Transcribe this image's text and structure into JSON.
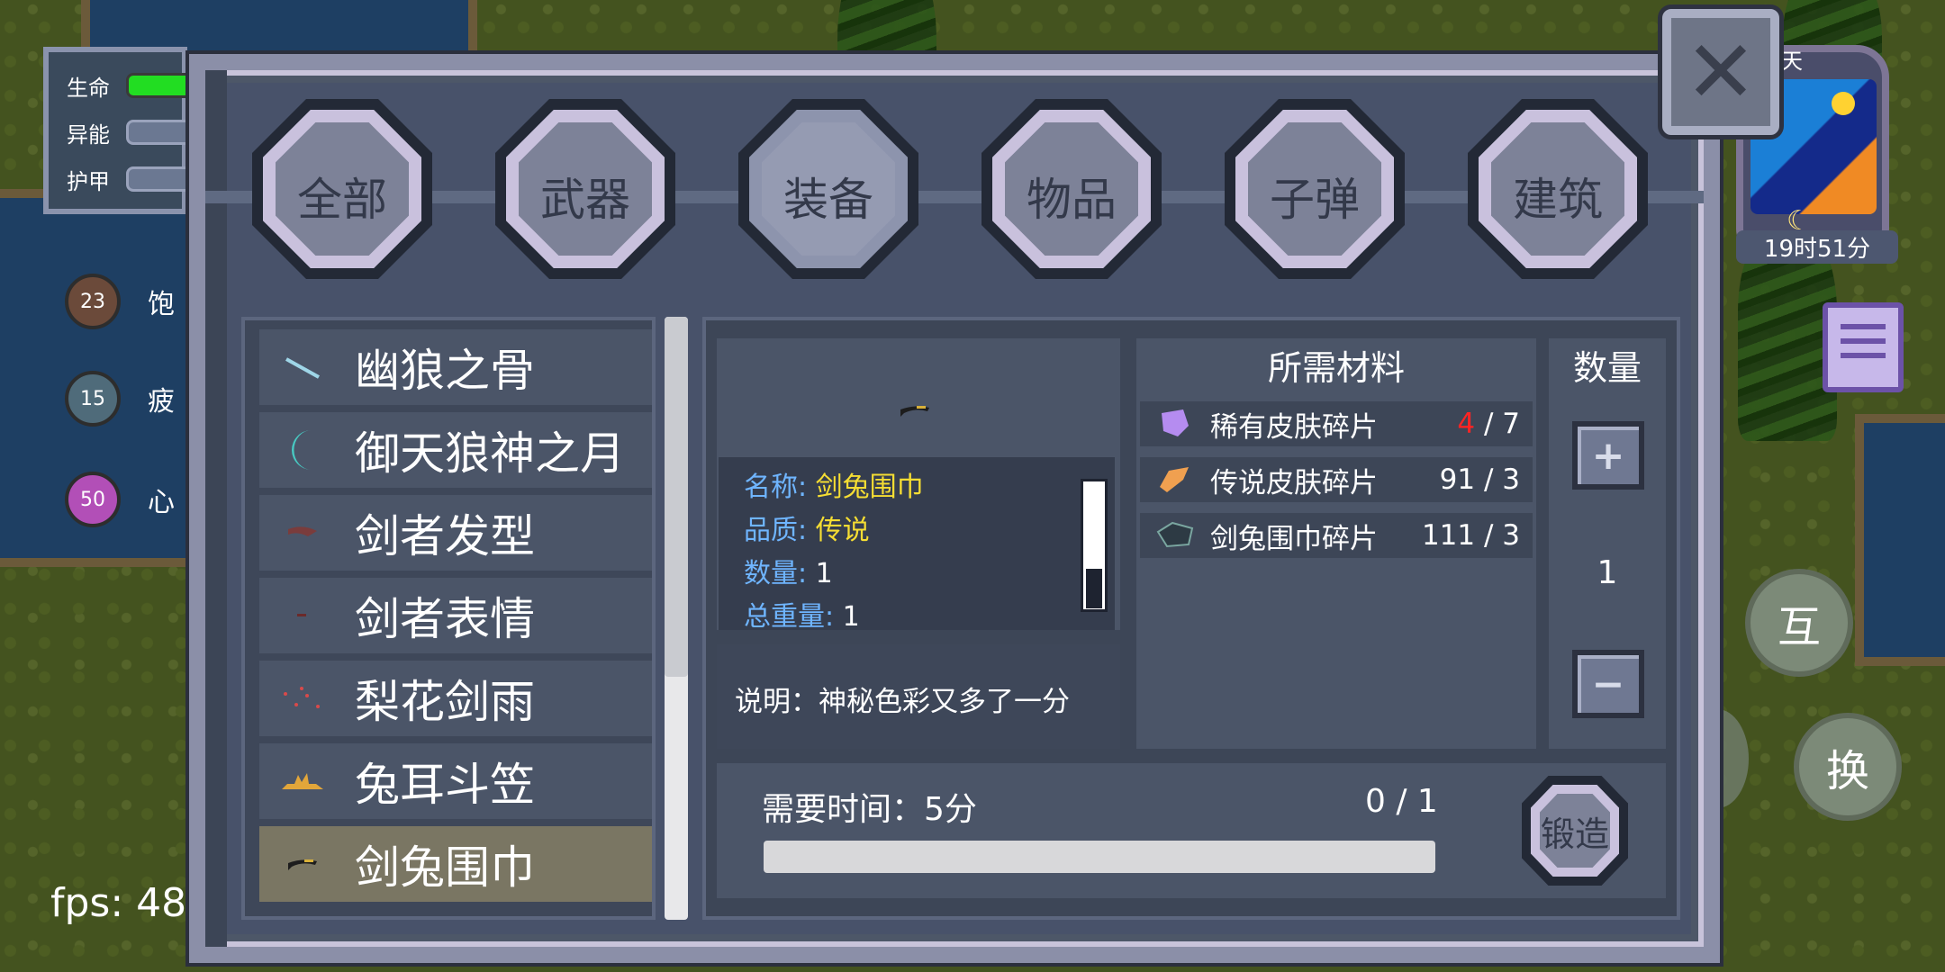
{
  "hud": {
    "stats": [
      {
        "label": "生命",
        "color": "#22dd22"
      },
      {
        "label": "异能",
        "color": "#6b7892"
      },
      {
        "label": "护甲",
        "color": "#6b7892"
      }
    ],
    "status": [
      {
        "value": "23",
        "text": "饱",
        "color": "#6b4a3a"
      },
      {
        "value": "15",
        "text": "疲",
        "color": "#4f6b7a"
      },
      {
        "value": "50",
        "text": "心",
        "color": "#b24fb7"
      }
    ],
    "fps": "fps: 48",
    "clock_top_label": "天",
    "clock_time": "19时51分",
    "interact_button": "互",
    "swap_button": "换"
  },
  "tabs": [
    {
      "label": "全部",
      "active": false
    },
    {
      "label": "武器",
      "active": false
    },
    {
      "label": "装备",
      "active": true
    },
    {
      "label": "物品",
      "active": false
    },
    {
      "label": "子弹",
      "active": false
    },
    {
      "label": "建筑",
      "active": false
    }
  ],
  "items": [
    {
      "label": "幽狼之骨",
      "icon": "bone-icon",
      "selected": false
    },
    {
      "label": "御天狼神之月",
      "icon": "crescent-moon-icon",
      "selected": false
    },
    {
      "label": "剑者发型",
      "icon": "hair-icon",
      "selected": false
    },
    {
      "label": "剑者表情",
      "icon": "face-icon",
      "selected": false
    },
    {
      "label": "梨花剑雨",
      "icon": "petals-icon",
      "selected": false
    },
    {
      "label": "兔耳斗笠",
      "icon": "hat-icon",
      "selected": false
    },
    {
      "label": "剑兔围巾",
      "icon": "scarf-icon",
      "selected": true
    }
  ],
  "detail": {
    "name_key": "名称:",
    "name_value": "剑兔围巾",
    "quality_key": "品质:",
    "quality_value": "传说",
    "count_key": "数量:",
    "count_value": "1",
    "weight_key": "总重量:",
    "weight_value": "1",
    "description": "说明：神秘色彩又多了一分"
  },
  "materials": {
    "title": "所需材料",
    "rows": [
      {
        "name": "稀有皮肤碎片",
        "have": "4",
        "need": "/ 7",
        "insufficient": true,
        "icon": "purple-fragment-icon",
        "color": "#b58cf0"
      },
      {
        "name": "传说皮肤碎片",
        "have": "91",
        "need": "/ 3",
        "insufficient": false,
        "icon": "orange-fragment-icon",
        "color": "#f0a050"
      },
      {
        "name": "剑兔围巾碎片",
        "have": "111",
        "need": "/ 3",
        "insufficient": false,
        "icon": "scarf-fragment-icon",
        "color": "#2d3a44"
      }
    ]
  },
  "quantity": {
    "title": "数量",
    "value": "1",
    "plus": "+",
    "minus": "−"
  },
  "forge": {
    "time_label": "需要时间：5分",
    "progress_text": "0 / 1",
    "progress": 0,
    "button": "锻造"
  }
}
